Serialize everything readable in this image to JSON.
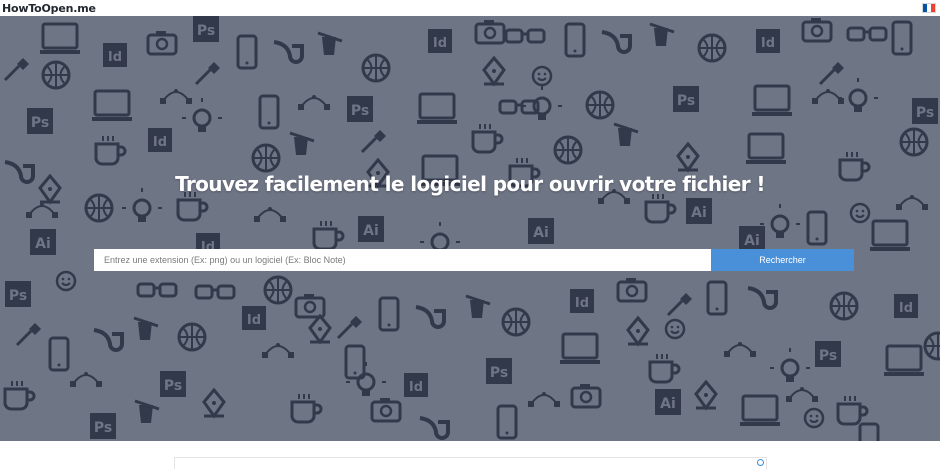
{
  "header": {
    "logo_text": "HowToOpen.me",
    "language_flag": "flag-france-icon",
    "flag_colors": [
      "#0055a4",
      "#ffffff",
      "#ef4135"
    ]
  },
  "hero": {
    "headline": "Trouvez facilement le logiciel pour ouvrir votre fichier !",
    "background_color": "#6e7585",
    "pattern_color": "#2f3648"
  },
  "search": {
    "value": "",
    "placeholder": "Entrez une extension (Ex: png) ou un logiciel (Ex: Bloc Note)",
    "button_label": "Rechercher",
    "button_color": "#4a90d9"
  },
  "pattern_icons": {
    "ps": "Ps",
    "ai": "Ai",
    "id": "Id"
  }
}
